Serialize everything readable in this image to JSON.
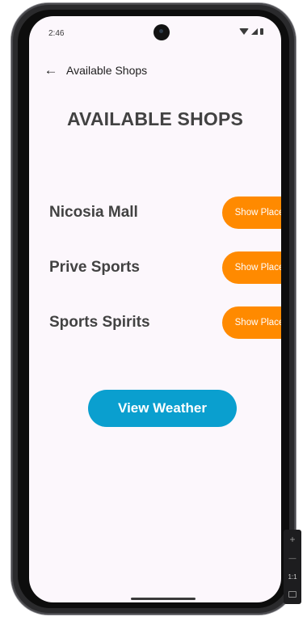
{
  "status_bar": {
    "time": "2:46",
    "icons": [
      "wifi-icon",
      "signal-icon",
      "battery-icon"
    ]
  },
  "app_bar": {
    "back_icon": "←",
    "title": "Available Shops"
  },
  "page": {
    "heading": "AVAILABLE SHOPS"
  },
  "shops": [
    {
      "name": "Nicosia Mall",
      "button_label": "Show Place"
    },
    {
      "name": "Prive Sports",
      "button_label": "Show Place"
    },
    {
      "name": "Sports Spirits",
      "button_label": "Show Place"
    }
  ],
  "actions": {
    "view_weather_label": "View Weather"
  },
  "emulator_controls": {
    "zoom_in": "+",
    "zoom_out": "—",
    "ratio": "1:1"
  },
  "colors": {
    "screen_background": "#fcf7fc",
    "show_place_button": "#ff8a00",
    "view_weather_button": "#0a9fcf",
    "text_primary": "#424242"
  }
}
